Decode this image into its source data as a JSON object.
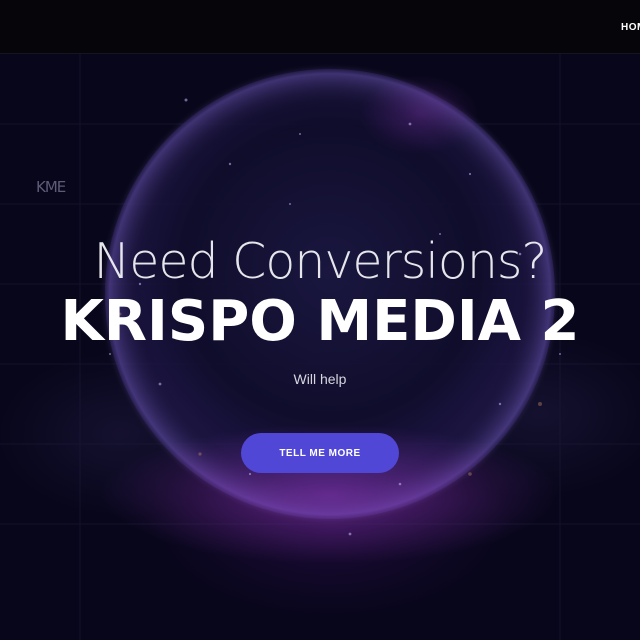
{
  "nav": {
    "home_label": "HOME"
  },
  "hero": {
    "mark": "KME",
    "subtitle": "Need Conversions?",
    "title": "KRISPO MEDIA 2",
    "tagline": "Will help",
    "cta_label": "TELL ME MORE"
  },
  "colors": {
    "accent": "#5047d6",
    "background": "#05040c",
    "text": "#ffffff"
  }
}
